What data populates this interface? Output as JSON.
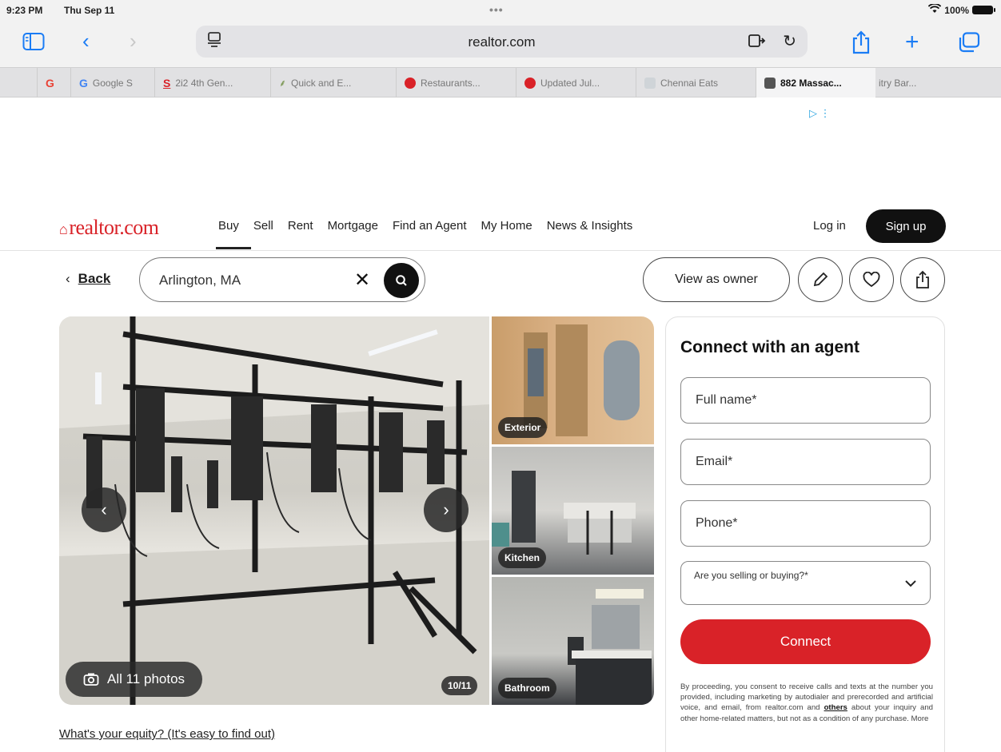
{
  "status_bar": {
    "time": "9:23 PM",
    "date": "Thu Sep 11",
    "battery": "100%"
  },
  "browser": {
    "url": "realtor.com",
    "tabs": [
      {
        "label": "G",
        "color": "#e94235"
      },
      {
        "label": "Google S",
        "color": "#4285f4"
      },
      {
        "label": "2i2 4th Gen...",
        "color": "#d92228"
      },
      {
        "label": "Quick and E...",
        "color": "#6a8a3a"
      },
      {
        "label": "Restaurants...",
        "color": "#d92228"
      },
      {
        "label": "Updated Jul...",
        "color": "#d92228"
      },
      {
        "label": "Chennai Eats",
        "color": "#9a9a9a"
      },
      {
        "label": "882 Massac...",
        "color": "#555555"
      },
      {
        "label": "itry Bar...",
        "color": "#9a9a9a"
      }
    ]
  },
  "site": {
    "logo": "realtor.com",
    "nav": [
      "Buy",
      "Sell",
      "Rent",
      "Mortgage",
      "Find an Agent",
      "My Home",
      "News & Insights"
    ],
    "login": "Log in",
    "signup": "Sign up"
  },
  "search_row": {
    "back": "Back",
    "search_value": "Arlington, MA",
    "view_as_owner": "View as owner"
  },
  "gallery": {
    "all_photos": "All 11 photos",
    "counter": "10/11",
    "thumbs": [
      "Exterior",
      "Kitchen",
      "Bathroom"
    ]
  },
  "agent_form": {
    "title": "Connect with an agent",
    "full_name": "Full name*",
    "email": "Email*",
    "phone": "Phone*",
    "selling_buying": "Are you selling or buying?*",
    "connect": "Connect",
    "consent_pre": "By proceeding, you consent to receive calls and texts at the number you provided, including marketing by autodialer and prerecorded and artificial voice, and email, from realtor.com and ",
    "consent_link": "others",
    "consent_post": " about your inquiry and other home-related matters, but not as a condition of any purchase. More"
  },
  "equity_link": "What's your equity? (It's easy to find out)",
  "colors": {
    "brand_red": "#d92228",
    "link_blue": "#1a7cf5"
  }
}
